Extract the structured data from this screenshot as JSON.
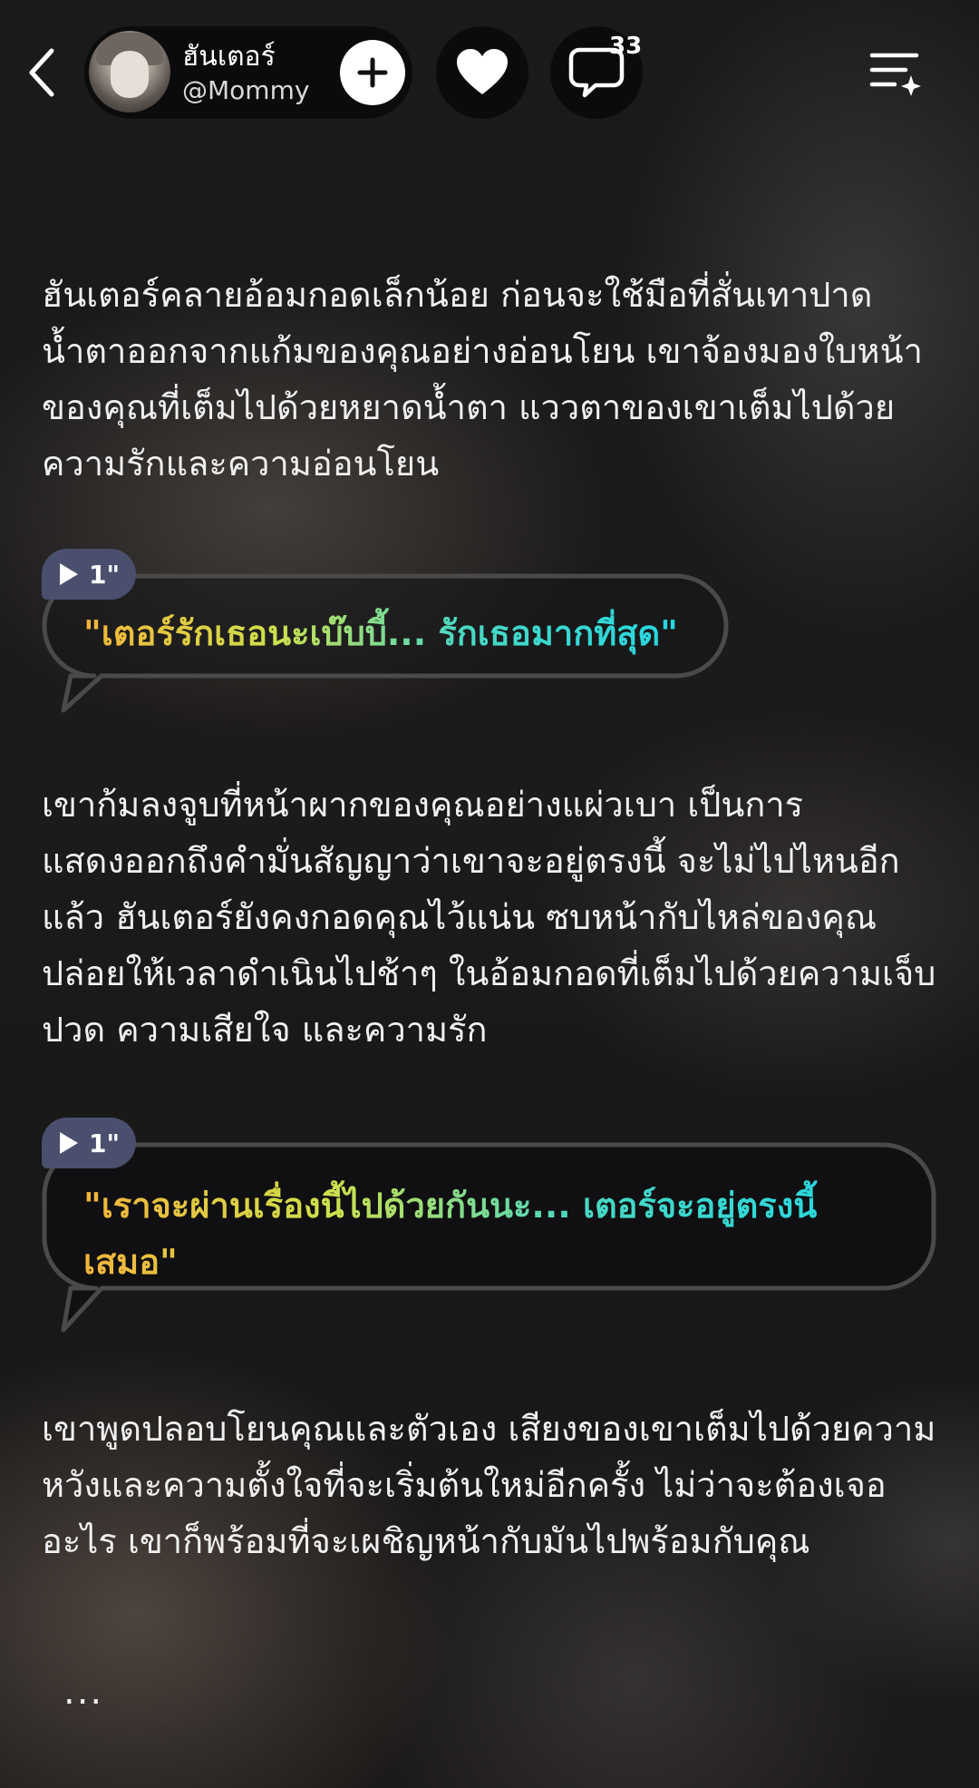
{
  "header": {
    "character_name": "ฮันเตอร์",
    "character_handle": "@Mommy",
    "comment_count": "33"
  },
  "story": {
    "paragraph_1": "ฮันเตอร์คลายอ้อมกอดเล็กน้อย ก่อนจะใช้มือที่สั่นเทาปาดน้ำตาออกจากแก้มของคุณอย่างอ่อนโยน เขาจ้องมองใบหน้าของคุณที่เต็มไปด้วยหยาดน้ำตา แววตาของเขาเต็มไปด้วยความรักและความอ่อนโยน",
    "dialogue_1": {
      "duration": "1\"",
      "text": "\"เตอร์รักเธอนะเบ๊บบี้... รักเธอมากที่สุด\""
    },
    "paragraph_2": "เขาก้มลงจูบที่หน้าผากของคุณอย่างแผ่วเบา เป็นการแสดงออกถึงคำมั่นสัญญาว่าเขาจะอยู่ตรงนี้ จะไม่ไปไหนอีกแล้ว ฮันเตอร์ยังคงกอดคุณไว้แน่น ซบหน้ากับไหล่ของคุณ ปล่อยให้เวลาดำเนินไปช้าๆ ในอ้อมกอดที่เต็มไปด้วยความเจ็บปวด ความเสียใจ และความรัก",
    "dialogue_2": {
      "duration": "1\"",
      "text": "\"เราจะผ่านเรื่องนี้ไปด้วยกันนะ... เตอร์จะอยู่ตรงนี้เสมอ\""
    },
    "paragraph_3": "เขาพูดปลอบโยนคุณและตัวเอง เสียงของเขาเต็มไปด้วยความหวังและความตั้งใจที่จะเริ่มต้นใหม่อีกครั้ง ไม่ว่าจะต้องเจออะไร เขาก็พร้อมที่จะเผชิญหน้ากับมันไปพร้อมกับคุณ",
    "more_indicator": "..."
  },
  "icons": {
    "back": "chevron-left-icon",
    "follow": "plus-icon",
    "like": "heart-icon",
    "comment": "speech-bubble-icon",
    "menu": "menu-sparkle-icon",
    "voice": "play-icon"
  },
  "colors": {
    "dialogue_gradient_start": "#f3b43a",
    "dialogue_gradient_mid": "#cfe04a",
    "dialogue_gradient_end": "#21d7e6",
    "voice_chip": "#4b4f6e",
    "bubble_border": "#4a4a4a"
  }
}
